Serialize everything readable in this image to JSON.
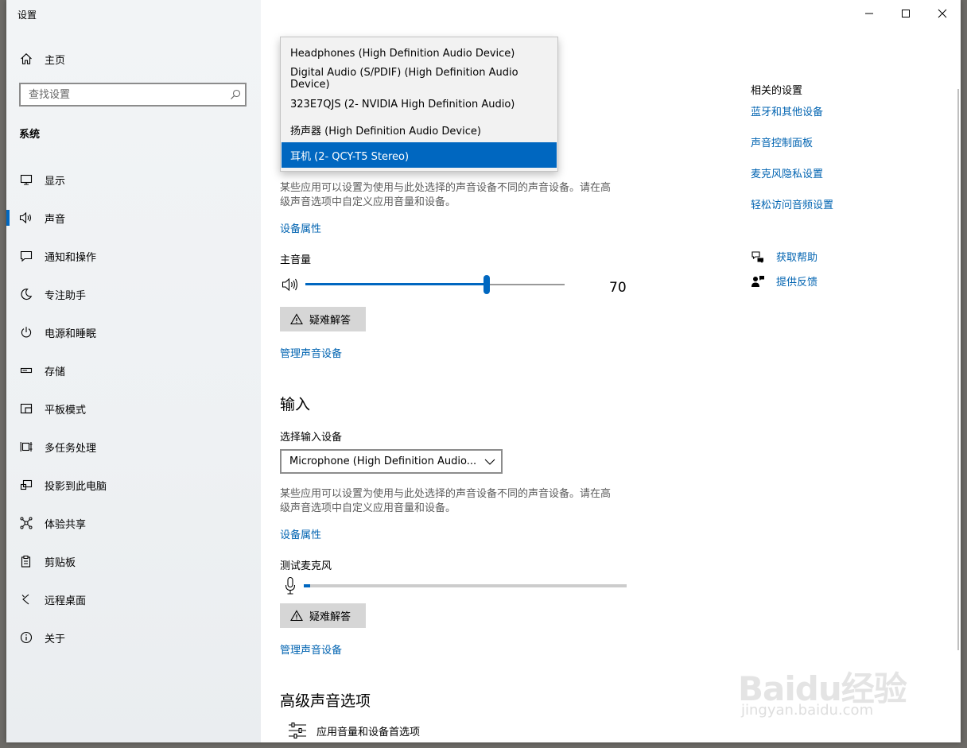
{
  "window": {
    "title": "设置"
  },
  "sidebar": {
    "home_label": "主页",
    "search_placeholder": "查找设置",
    "section_title": "系统",
    "items": [
      {
        "label": "显示",
        "icon": "monitor-icon"
      },
      {
        "label": "声音",
        "icon": "speaker-icon",
        "active": true
      },
      {
        "label": "通知和操作",
        "icon": "notification-icon"
      },
      {
        "label": "专注助手",
        "icon": "moon-icon"
      },
      {
        "label": "电源和睡眠",
        "icon": "power-icon"
      },
      {
        "label": "存储",
        "icon": "storage-icon"
      },
      {
        "label": "平板模式",
        "icon": "tablet-icon"
      },
      {
        "label": "多任务处理",
        "icon": "multitask-icon"
      },
      {
        "label": "投影到此电脑",
        "icon": "project-icon"
      },
      {
        "label": "体验共享",
        "icon": "share-icon"
      },
      {
        "label": "剪贴板",
        "icon": "clipboard-icon"
      },
      {
        "label": "远程桌面",
        "icon": "remote-desktop-icon"
      },
      {
        "label": "关于",
        "icon": "info-icon"
      }
    ]
  },
  "output": {
    "dropdown_options": [
      "Headphones (High Definition Audio Device)",
      "Digital Audio (S/PDIF) (High Definition Audio Device)",
      "323E7QJS (2- NVIDIA High Definition Audio)",
      "扬声器 (High Definition Audio Device)",
      "耳机 (2- QCY-T5 Stereo)"
    ],
    "selected_option": "耳机 (2- QCY-T5 Stereo)",
    "description_line1": "某些应用可以设置为使用与此处选择的声音设备不同的声音设备。请在高",
    "description_line2": "级声音选项中自定义应用音量和设备。",
    "device_properties_link": "设备属性",
    "master_volume_label": "主音量",
    "master_volume_value": "70",
    "master_volume_fraction": 0.7,
    "troubleshoot_label": "疑难解答",
    "manage_devices_link": "管理声音设备"
  },
  "input": {
    "heading": "输入",
    "select_label": "选择输入设备",
    "selected_device": "Microphone (High Definition Audio...",
    "description_line1": "某些应用可以设置为使用与此处选择的声音设备不同的声音设备。请在高",
    "description_line2": "级声音选项中自定义应用音量和设备。",
    "device_properties_link": "设备属性",
    "test_mic_label": "测试麦克风",
    "mic_level_fraction": 0.02,
    "troubleshoot_label": "疑难解答",
    "manage_devices_link": "管理声音设备"
  },
  "advanced": {
    "heading": "高级声音选项",
    "app_volume_label": "应用音量和设备首选项"
  },
  "related": {
    "title": "相关的设置",
    "links": [
      "蓝牙和其他设备",
      "声音控制面板",
      "麦克风隐私设置",
      "轻松访问音频设置"
    ],
    "help_label": "获取帮助",
    "feedback_label": "提供反馈"
  },
  "watermark": {
    "logo": "Baidu经验",
    "url": "jingyan.baidu.com"
  },
  "colors": {
    "accent": "#0067c0",
    "link": "#0063b1"
  }
}
